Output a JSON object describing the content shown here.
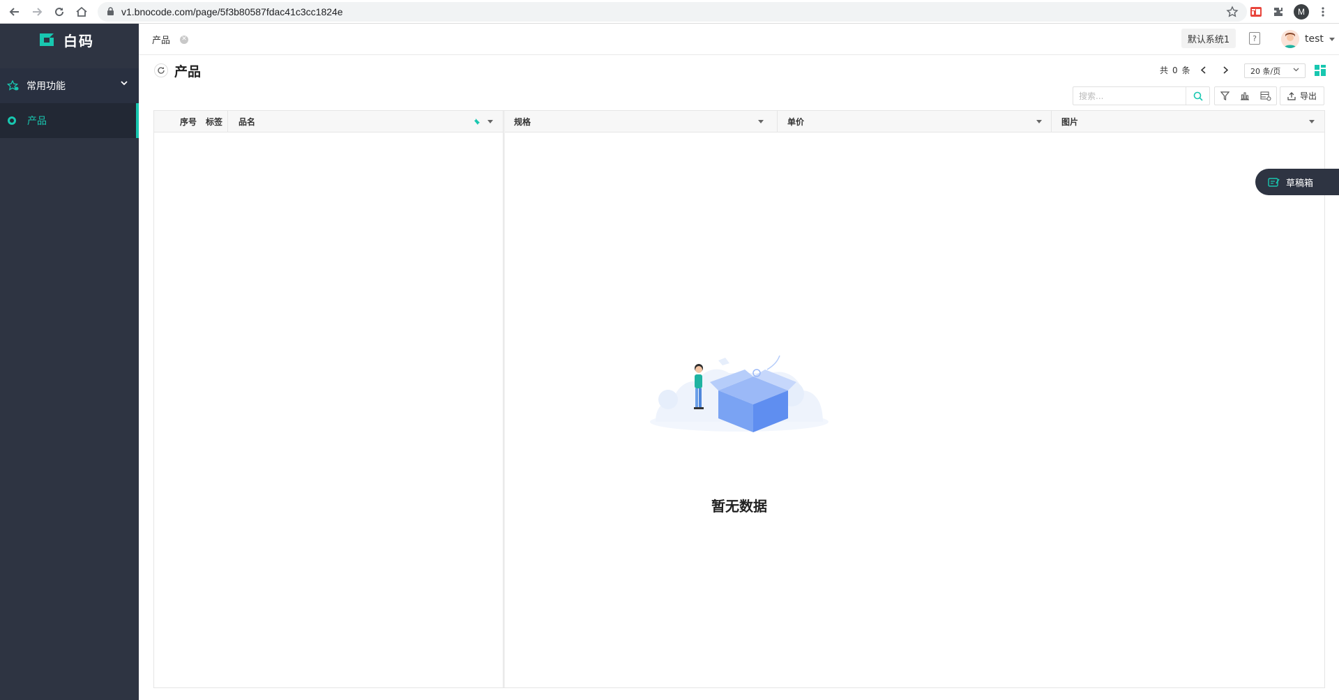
{
  "browser": {
    "url": "v1.bnocode.com/page/5f3b80587fdac41c3cc1824e",
    "profile_initial": "M"
  },
  "sidebar": {
    "logo_text": "白码",
    "group_label": "常用功能",
    "items": [
      {
        "label": "产品",
        "active": true
      }
    ]
  },
  "header": {
    "tab_label": "产品",
    "system_button": "默认系统1",
    "help_label": "?",
    "user_name": "test"
  },
  "page": {
    "title": "产品",
    "total_prefix": "共",
    "total_count": "0",
    "total_suffix": "条",
    "page_size": "20 条/页",
    "search_placeholder": "搜索...",
    "export_label": "导出",
    "empty_text": "暂无数据"
  },
  "table": {
    "columns": {
      "index": "序号",
      "tag": "标签",
      "name": "品名",
      "spec": "规格",
      "price": "单价",
      "image": "图片"
    },
    "rows": []
  },
  "draft_box": {
    "label": "草稿箱"
  },
  "colors": {
    "accent": "#18c7b0",
    "sidebar_bg": "#2e3442"
  }
}
